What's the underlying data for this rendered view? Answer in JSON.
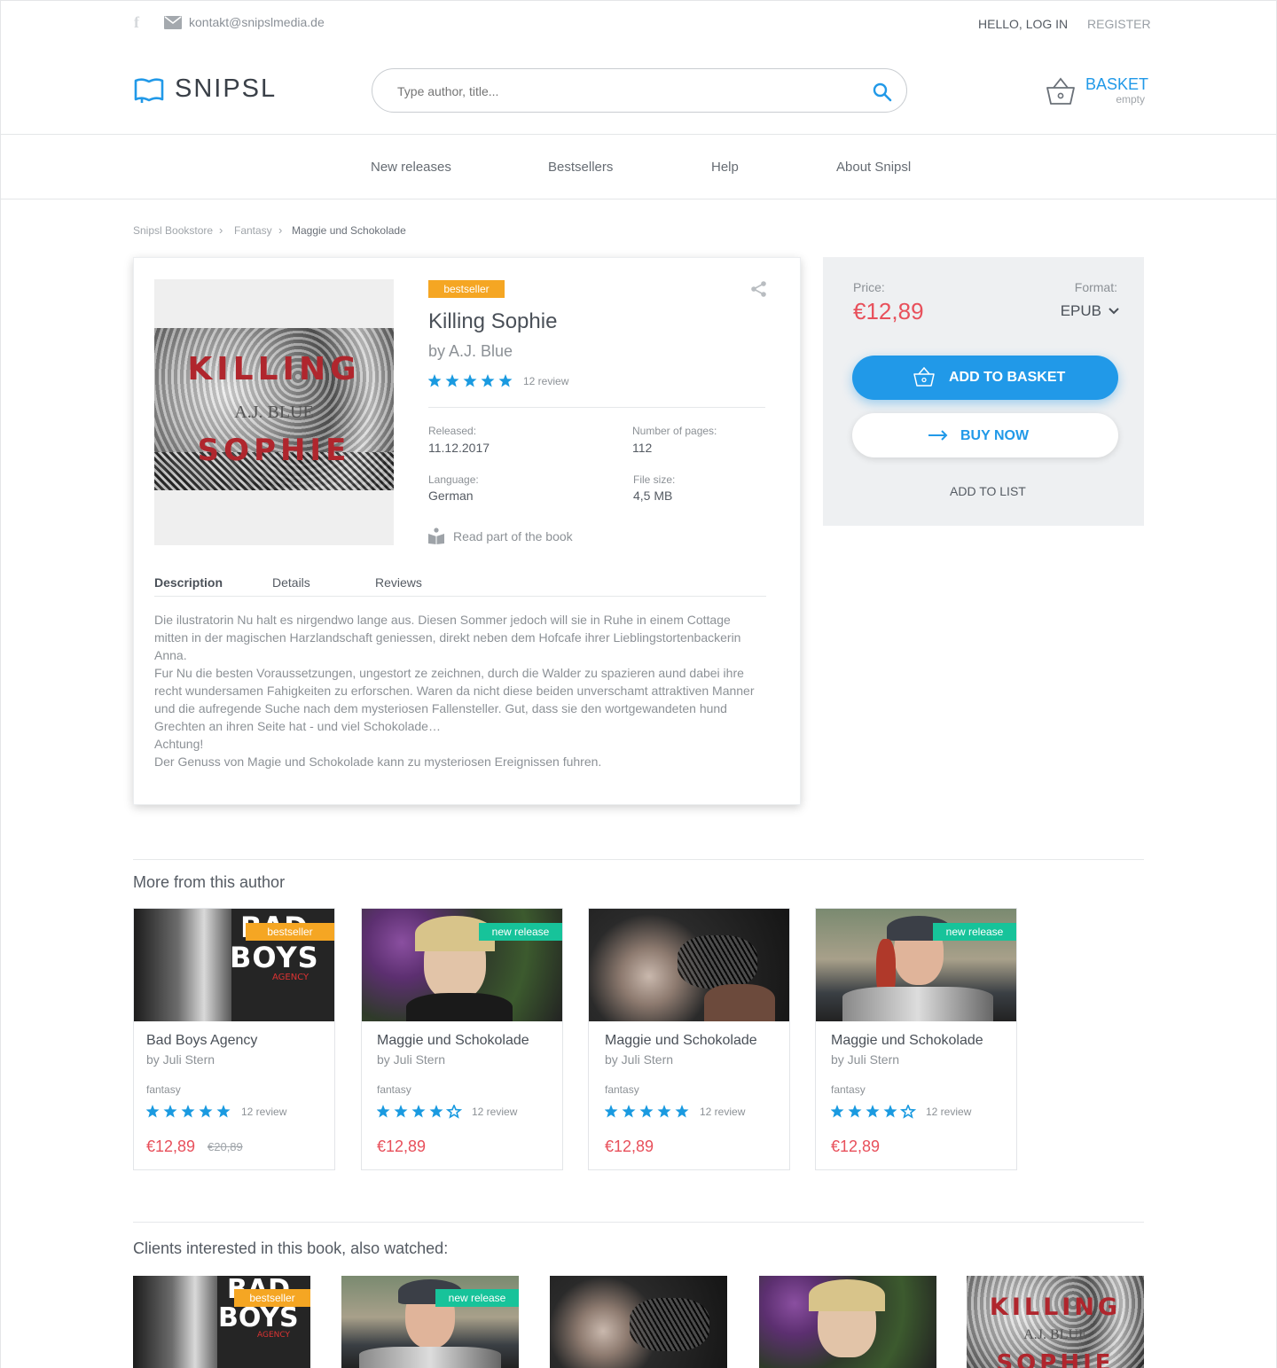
{
  "topbar": {
    "email": "kontakt@snipslmedia.de",
    "login": "HELLO, LOG IN",
    "register": "REGISTER"
  },
  "header": {
    "logo": "SNIPSL",
    "search_placeholder": "Type author, title...",
    "basket_label": "BASKET",
    "basket_status": "empty"
  },
  "nav": [
    "New releases",
    "Bestsellers",
    "Help",
    "About Snipsl"
  ],
  "breadcrumb": [
    "Snipsl Bookstore",
    "Fantasy",
    "Maggie und Schokolade"
  ],
  "book": {
    "badge": "bestseller",
    "title": "Killing Sophie",
    "author": "by A.J. Blue",
    "rating": 5,
    "reviews": "12 review",
    "cover_title_top": "KILLING",
    "cover_author": "A.J. BLUE",
    "cover_title_bottom": "SOPHIE",
    "released_label": "Released:",
    "released": "11.12.2017",
    "pages_label": "Number of pages:",
    "pages": "112",
    "language_label": "Language:",
    "language": "German",
    "filesize_label": "File size:",
    "filesize": "4,5 MB",
    "read_part": "Read part of the book",
    "tabs": [
      "Description",
      "Details",
      "Reviews"
    ],
    "description": [
      "Die ilustratorin Nu halt es nirgendwo lange aus. Diesen Sommer jedoch will sie in Ruhe in einem Cottage",
      "mitten in der magischen Harzlandschaft geniessen, direkt neben dem Hofcafe ihrer Lieblingstortenbackerin",
      "Anna.",
      "Fur Nu die besten Voraussetzungen, ungestort ze zeichnen, durch die Walder zu spazieren aund dabei ihre",
      "recht wundersamen Fahigkeiten zu erforschen. Waren da nicht diese beiden unverschamt attraktiven Manner",
      "und die aufregende Suche nach dem mysteriosen Fallensteller. Gut, dass sie den wortgewandeten hund",
      "Grechten an ihren Seite hat - und viel Schokolade…",
      "Achtung!",
      "Der Genuss von Magie und Schokolade kann zu mysteriosen Ereignissen fuhren."
    ]
  },
  "purchase": {
    "price_label": "Price:",
    "price": "€12,89",
    "format_label": "Format:",
    "format": "EPUB",
    "add_to_basket": "ADD TO BASKET",
    "buy_now": "BUY NOW",
    "add_to_list": "ADD TO LIST"
  },
  "more_from_author": {
    "heading": "More from this author",
    "items": [
      {
        "title": "Bad Boys Agency",
        "author": "by Juli Stern",
        "genre": "fantasy",
        "rating": 5,
        "reviews": "12 review",
        "price": "€12,89",
        "old_price": "€20,89",
        "badge": "bestseller",
        "cover_text_1": "BAD",
        "cover_text_2": "BOYS",
        "cover_text_3": "AGENCY"
      },
      {
        "title": "Maggie und Schokolade",
        "author": "by Juli Stern",
        "genre": "fantasy",
        "rating": 4,
        "reviews": "12 review",
        "price": "€12,89",
        "badge": "new release"
      },
      {
        "title": "Maggie und Schokolade",
        "author": "by Juli Stern",
        "genre": "fantasy",
        "rating": 5,
        "reviews": "12 review",
        "price": "€12,89"
      },
      {
        "title": "Maggie und Schokolade",
        "author": "by Juli Stern",
        "genre": "fantasy",
        "rating": 4,
        "reviews": "12 review",
        "price": "€12,89",
        "badge": "new release"
      }
    ]
  },
  "also_watched": {
    "heading": "Clients interested in this book, also watched:",
    "items": [
      {
        "badge": "bestseller",
        "cover_text_1": "BAD",
        "cover_text_2": "BOYS",
        "cover_text_3": "AGENCY"
      },
      {
        "badge": "new release"
      },
      {},
      {},
      {
        "cover_text_1": "KILLING",
        "cover_text_2": "A.J. BLUE",
        "cover_text_3": "SOPHIE"
      }
    ]
  },
  "colors": {
    "accent": "#2199e8",
    "price": "#e8505b",
    "bestseller": "#f5a623",
    "new_release": "#17c39a"
  }
}
